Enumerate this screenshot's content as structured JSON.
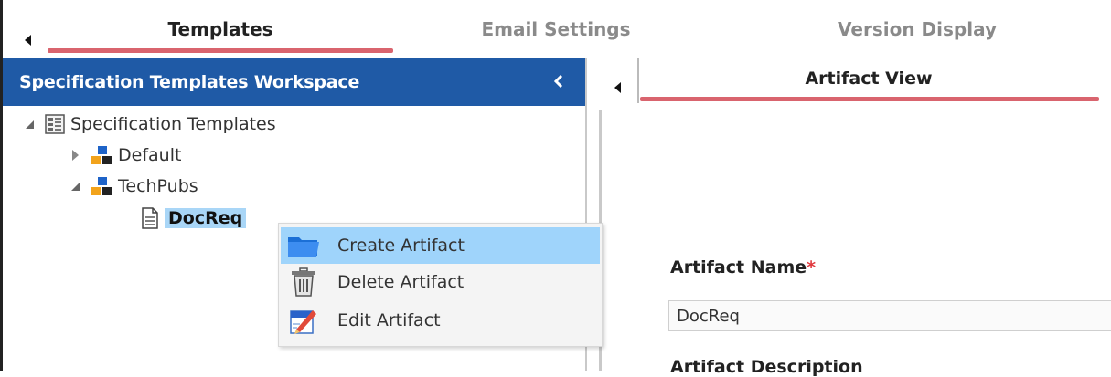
{
  "top_tabs": {
    "items": [
      {
        "label": "Templates",
        "active": true
      },
      {
        "label": "Email Settings",
        "active": false
      },
      {
        "label": "Version Display",
        "active": false
      }
    ]
  },
  "workspace": {
    "title": "Specification Templates Workspace",
    "tree": {
      "root": "Specification Templates",
      "default": "Default",
      "techpubs": "TechPubs",
      "docreq": "DocReq"
    }
  },
  "context_menu": {
    "items": [
      {
        "label": "Create Artifact",
        "icon": "folder-icon"
      },
      {
        "label": "Delete Artifact",
        "icon": "trash-icon"
      },
      {
        "label": "Edit Artifact",
        "icon": "edit-icon"
      }
    ]
  },
  "artifact_view": {
    "tab_label": "Artifact View",
    "name_label": "Artifact Name",
    "required_marker": "*",
    "name_value": "DocReq",
    "description_label": "Artifact Description"
  },
  "colors": {
    "header_blue": "#1f5aa6",
    "tab_underline": "#d9646e",
    "selection": "#a9d6f7",
    "menu_hover": "#9fd4fb",
    "required": "#e0393e"
  }
}
